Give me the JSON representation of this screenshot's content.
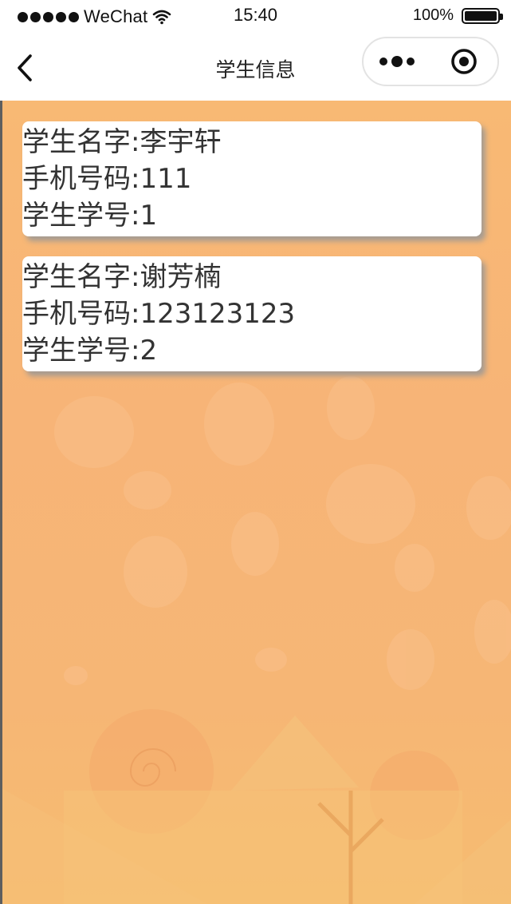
{
  "status_bar": {
    "carrier": "WeChat",
    "time": "15:40",
    "battery_label": "100%",
    "battery_level": 1.0
  },
  "nav": {
    "title": "学生信息",
    "icons": [
      "chevron-left-icon",
      "more-dots-icon",
      "target-circle-icon"
    ]
  },
  "students": [
    {
      "name_label": "学生名字:李宇轩",
      "phone_label": "手机号码:111",
      "id_label": "学生学号:1"
    },
    {
      "name_label": "学生名字:谢芳楠",
      "phone_label": "手机号码:123123123",
      "id_label": "学生学号:2"
    }
  ],
  "colors": {
    "background_orange": "#f7b477",
    "card": "#ffffff",
    "text": "#333333"
  }
}
